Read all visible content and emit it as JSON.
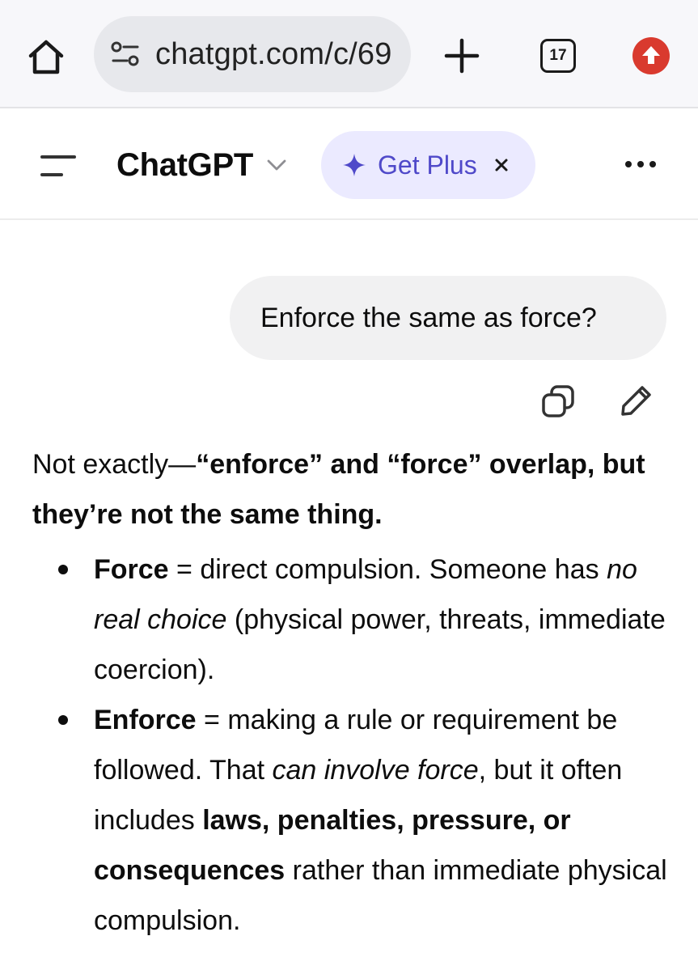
{
  "browser": {
    "url": "chatgpt.com/c/69",
    "tab_count": "17"
  },
  "header": {
    "model_name": "ChatGPT",
    "upsell_label": "Get Plus"
  },
  "conversation": {
    "user_message": "Enforce the same as force?",
    "assistant": {
      "intro_plain": "Not exactly—",
      "intro_bold": "“enforce” and “force” overlap, but they’re not the same thing.",
      "bullets": [
        {
          "term": "Force",
          "sep": " = direct compulsion. Someone has ",
          "italic": "no real choice",
          "rest": " (physical power, threats, immediate coercion)."
        },
        {
          "term": "Enforce",
          "sep": " = making a rule or requirement be followed. That ",
          "italic": "can involve force",
          "mid": ", but it often includes ",
          "bold": "laws, penalties, pressure, or consequences",
          "rest": " rather than immediate physical compulsion."
        }
      ]
    }
  },
  "icons": {
    "home": "home-icon",
    "site_settings": "tune-icon",
    "new_tab": "plus-icon",
    "tabs": "tab-switcher-icon",
    "update": "update-arrow-icon",
    "menu": "menu-icon",
    "chevron": "chevron-down-icon",
    "sparkle": "sparkle-icon",
    "close": "close-icon",
    "more": "more-horizontal-icon",
    "copy": "copy-icon",
    "edit": "pencil-icon"
  },
  "colors": {
    "upsell_bg": "#ebeaff",
    "upsell_text": "#4f49c9",
    "update_badge": "#d93a2e",
    "bubble_bg": "#f1f1f2"
  }
}
